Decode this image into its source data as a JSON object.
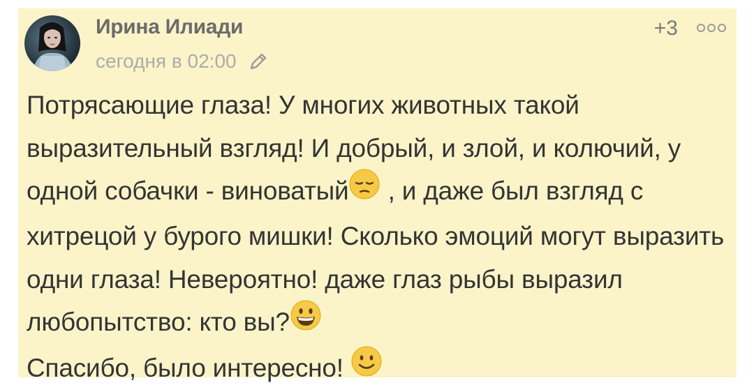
{
  "comment": {
    "author": "Ирина Илиади",
    "timestamp": "сегодня в 02:00",
    "rating": "+3",
    "text_part1": "Потрясающие глаза! У многих животных такой выразительный взгляд! И добрый, и злой, и колючий, у одной собачки - виноватый",
    "text_part2": " , и даже был взгляд с хитрецой у бурого мишки! Сколько эмоций могут выразить одни глаза! Невероятно! даже глаз рыбы выразил любопытство: кто вы?",
    "text_part3": "Спасибо, было интересно! ",
    "emoji1": "pensive-face-icon",
    "emoji2": "grinning-face-icon",
    "emoji3": "smiling-face-icon"
  },
  "colors": {
    "card_background": "#fbf4c9",
    "author": "#6b6b6b",
    "timestamp": "#ababab",
    "text": "#343434"
  },
  "icons": [
    "avatar",
    "pencil-edit-icon",
    "more-options-icon"
  ]
}
